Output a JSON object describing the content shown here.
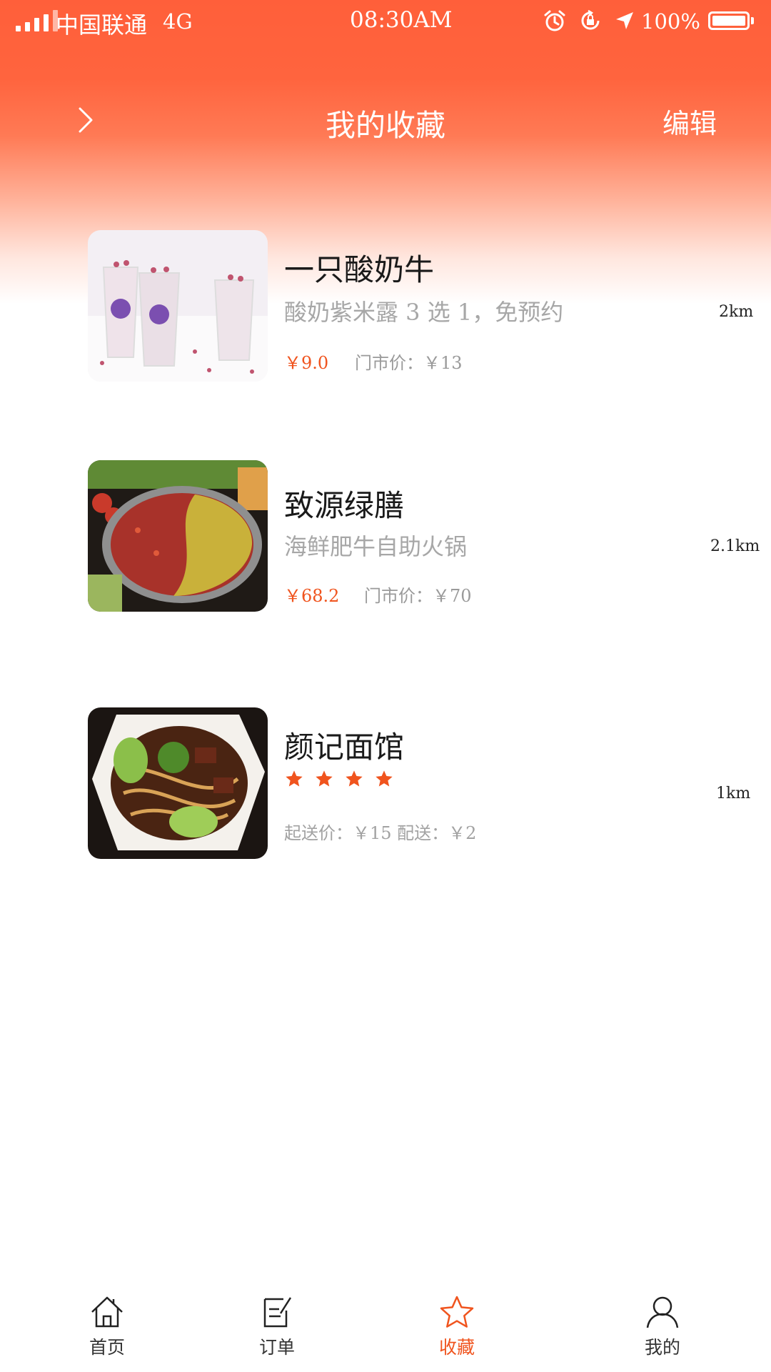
{
  "status_bar": {
    "carrier": "中国联通",
    "network": "4G",
    "time": "08:30AM",
    "battery": "100%"
  },
  "nav": {
    "title": "我的收藏",
    "edit_label": "编辑"
  },
  "favorites": [
    {
      "name": "一只酸奶牛",
      "desc": "酸奶紫米露 3 选 1，免预约",
      "price": "￥9.0",
      "orig_price": "门市价：￥13",
      "distance": "2km"
    },
    {
      "name": "致源绿膳",
      "desc": "海鲜肥牛自助火锅",
      "price": "￥68.2",
      "orig_price": "门市价：￥70",
      "distance": "2.1km"
    },
    {
      "name": "颜记面馆",
      "rating": 4,
      "fees": "起送价：￥15  配送：￥2",
      "distance": "1km"
    }
  ],
  "tabs": [
    {
      "label": "首页",
      "icon": "home-icon"
    },
    {
      "label": "订单",
      "icon": "order-icon"
    },
    {
      "label": "收藏",
      "icon": "star-icon",
      "active": true
    },
    {
      "label": "我的",
      "icon": "profile-icon"
    }
  ],
  "colors": {
    "accent": "#f0541e",
    "header": "#ff5f3a"
  }
}
